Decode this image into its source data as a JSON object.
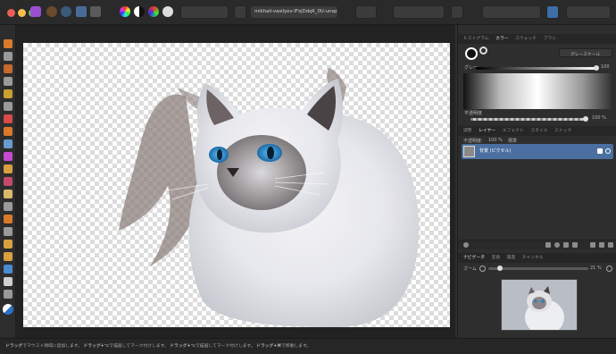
{
  "document": {
    "tab_label": "mikhail-vasilyev-IFxjDdqK_0U-unsplas ×"
  },
  "histogram_tabs": [
    "ヒストグラム",
    "カラー",
    "スウォッチ",
    "ブラシ"
  ],
  "color_panel": {
    "mode_label": "グレースケール",
    "gray_label": "グレー",
    "gray_value": "100",
    "opacity_label": "不透明度",
    "opacity_value": "100 %"
  },
  "layers_tabs": [
    "調整",
    "レイヤー",
    "エフェクト",
    "スタイル",
    "ストック"
  ],
  "layers_panel": {
    "opacity_label": "不透明度:",
    "opacity_value": "100 %",
    "blend_mode": "標準",
    "layer_name": "背景 (ピクセル)"
  },
  "navigator_tabs": [
    "ナビゲータ",
    "変換",
    "履歴",
    "チャンネル"
  ],
  "navigator": {
    "zoom_label": "ズーム",
    "zoom_value": "21 %"
  },
  "status": {
    "p1_bold": "ドラッグ",
    "p1": "でマウスト領域に追加します。",
    "p2_bold": "ドラッグ+⌥",
    "p2": "で描画してマーク付けします。",
    "p3_bold": "ドラッグ+⌥",
    "p3": "で描画してマーク付けします。",
    "p4_bold": "ドラッグ+⌘",
    "p4": "で移動します。"
  },
  "colors": {
    "accent": "#4b6fa0",
    "app_icon": "#9b4fd0"
  }
}
